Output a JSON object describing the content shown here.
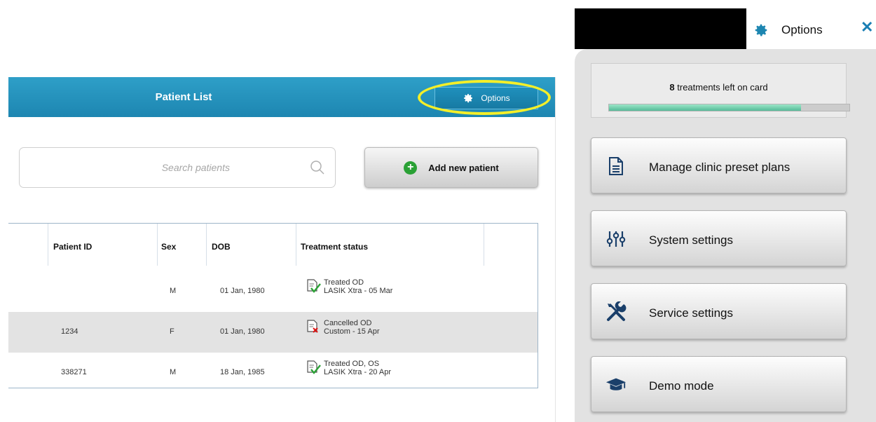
{
  "patient_list": {
    "title": "Patient List",
    "options_label": "Options",
    "search_placeholder": "Search patients",
    "add_patient_label": "Add new patient",
    "columns": [
      "Patient ID",
      "Sex",
      "DOB",
      "Treatment status"
    ],
    "rows": [
      {
        "patient_id": "",
        "sex": "M",
        "dob": "01 Jan, 1980",
        "status_line1": "Treated OD",
        "status_line2": "LASIK Xtra - 05 Mar",
        "status_icon": "check-icon"
      },
      {
        "patient_id": "1234",
        "sex": "F",
        "dob": "01 Jan, 1980",
        "status_line1": "Cancelled OD",
        "status_line2": "Custom - 15 Apr",
        "status_icon": "cancel-icon"
      },
      {
        "patient_id": "338271",
        "sex": "M",
        "dob": "18 Jan, 1985",
        "status_line1": "Treated OD, OS",
        "status_line2": "LASIK Xtra - 20 Apr",
        "status_icon": "check-icon"
      }
    ]
  },
  "options_panel": {
    "title": "Options",
    "card": {
      "count": "8",
      "text": " treatments left on card",
      "progress": 0.8
    },
    "buttons": [
      {
        "label": "Manage clinic preset plans",
        "icon": "document-icon"
      },
      {
        "label": "System settings",
        "icon": "sliders-icon"
      },
      {
        "label": "Service settings",
        "icon": "tools-icon"
      },
      {
        "label": "Demo mode",
        "icon": "graduation-cap-icon"
      }
    ]
  },
  "colors": {
    "header_blue": "#1d86b1",
    "accent_blue": "#1a7fb4",
    "highlight_yellow": "#f4ef29",
    "add_green": "#2aa135"
  }
}
